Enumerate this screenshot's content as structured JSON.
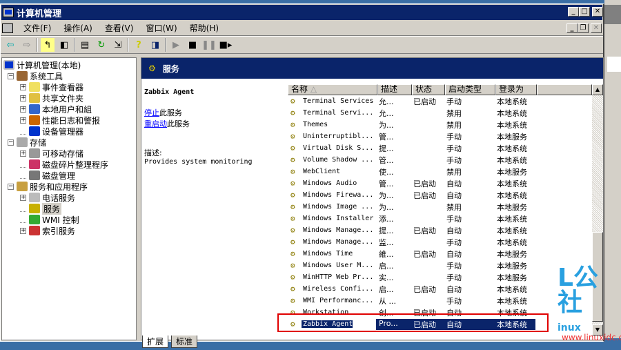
{
  "window": {
    "title": "计算机管理"
  },
  "menu": [
    "文件(F)",
    "操作(A)",
    "查看(V)",
    "窗口(W)",
    "帮助(H)"
  ],
  "tree": {
    "root": "计算机管理(本地)",
    "items": [
      {
        "label": "系统工具",
        "level": 1,
        "exp": "-"
      },
      {
        "label": "事件查看器",
        "level": 2,
        "exp": "+"
      },
      {
        "label": "共享文件夹",
        "level": 2,
        "exp": "+"
      },
      {
        "label": "本地用户和組",
        "level": 2,
        "exp": "+"
      },
      {
        "label": "性能日志和警报",
        "level": 2,
        "exp": "+"
      },
      {
        "label": "设备管理器",
        "level": 2,
        "exp": ""
      },
      {
        "label": "存储",
        "level": 1,
        "exp": "-"
      },
      {
        "label": "可移动存储",
        "level": 2,
        "exp": "+"
      },
      {
        "label": "磁盘碎片整理程序",
        "level": 2,
        "exp": ""
      },
      {
        "label": "磁盘管理",
        "level": 2,
        "exp": ""
      },
      {
        "label": "服务和应用程序",
        "level": 1,
        "exp": "-"
      },
      {
        "label": "电话服务",
        "level": 2,
        "exp": "+"
      },
      {
        "label": "服务",
        "level": 2,
        "exp": "",
        "selected": true
      },
      {
        "label": "WMI 控制",
        "level": 2,
        "exp": ""
      },
      {
        "label": "索引服务",
        "level": 2,
        "exp": "+"
      }
    ]
  },
  "panel": {
    "title": "服务",
    "service_name": "Zabbix Agent",
    "stop_link": "停止",
    "stop_suffix": "此服务",
    "restart_link": "重启动",
    "restart_suffix": "此服务",
    "desc_label": "描述:",
    "desc_text": "Provides system monitoring"
  },
  "columns": [
    "名称",
    "描述",
    "状态",
    "启动类型",
    "登录为"
  ],
  "rows": [
    [
      "Terminal Services",
      "允...",
      "已启动",
      "手动",
      "本地系统"
    ],
    [
      "Terminal Servi...",
      "允...",
      "",
      "禁用",
      "本地系统"
    ],
    [
      "Themes",
      "为...",
      "",
      "禁用",
      "本地系统"
    ],
    [
      "Uninterruptibl...",
      "管...",
      "",
      "手动",
      "本地服务"
    ],
    [
      "Virtual Disk S...",
      "提...",
      "",
      "手动",
      "本地系统"
    ],
    [
      "Volume Shadow ...",
      "管...",
      "",
      "手动",
      "本地系统"
    ],
    [
      "WebClient",
      "使...",
      "",
      "禁用",
      "本地服务"
    ],
    [
      "Windows Audio",
      "管...",
      "已启动",
      "自动",
      "本地系统"
    ],
    [
      "Windows Firewa...",
      "为...",
      "已启动",
      "自动",
      "本地系统"
    ],
    [
      "Windows Image ...",
      "为...",
      "",
      "禁用",
      "本地服务"
    ],
    [
      "Windows Installer",
      "添...",
      "",
      "手动",
      "本地系统"
    ],
    [
      "Windows Manage...",
      "提...",
      "已启动",
      "自动",
      "本地系统"
    ],
    [
      "Windows Manage...",
      "监...",
      "",
      "手动",
      "本地系统"
    ],
    [
      "Windows Time",
      "維...",
      "已启动",
      "自动",
      "本地服务"
    ],
    [
      "Windows User M...",
      "启...",
      "",
      "手动",
      "本地服务"
    ],
    [
      "WinHTTP Web Pr...",
      "实...",
      "",
      "手动",
      "本地服务"
    ],
    [
      "Wireless Confi...",
      "启...",
      "已启动",
      "自动",
      "本地系统"
    ],
    [
      "WMI Performanc...",
      "从 ...",
      "",
      "手动",
      "本地系统"
    ],
    [
      "Workstation",
      "创...",
      "已启动",
      "自动",
      "本地系统"
    ],
    [
      "Zabbix Agent",
      "Pro...",
      "已启动",
      "自动",
      "本地系统"
    ]
  ],
  "selected_row": 19,
  "tabs": [
    "扩展",
    "标准"
  ],
  "watermark": {
    "logo": "L公社",
    "sub": "inux",
    "url": "www.linuxidc.com"
  }
}
